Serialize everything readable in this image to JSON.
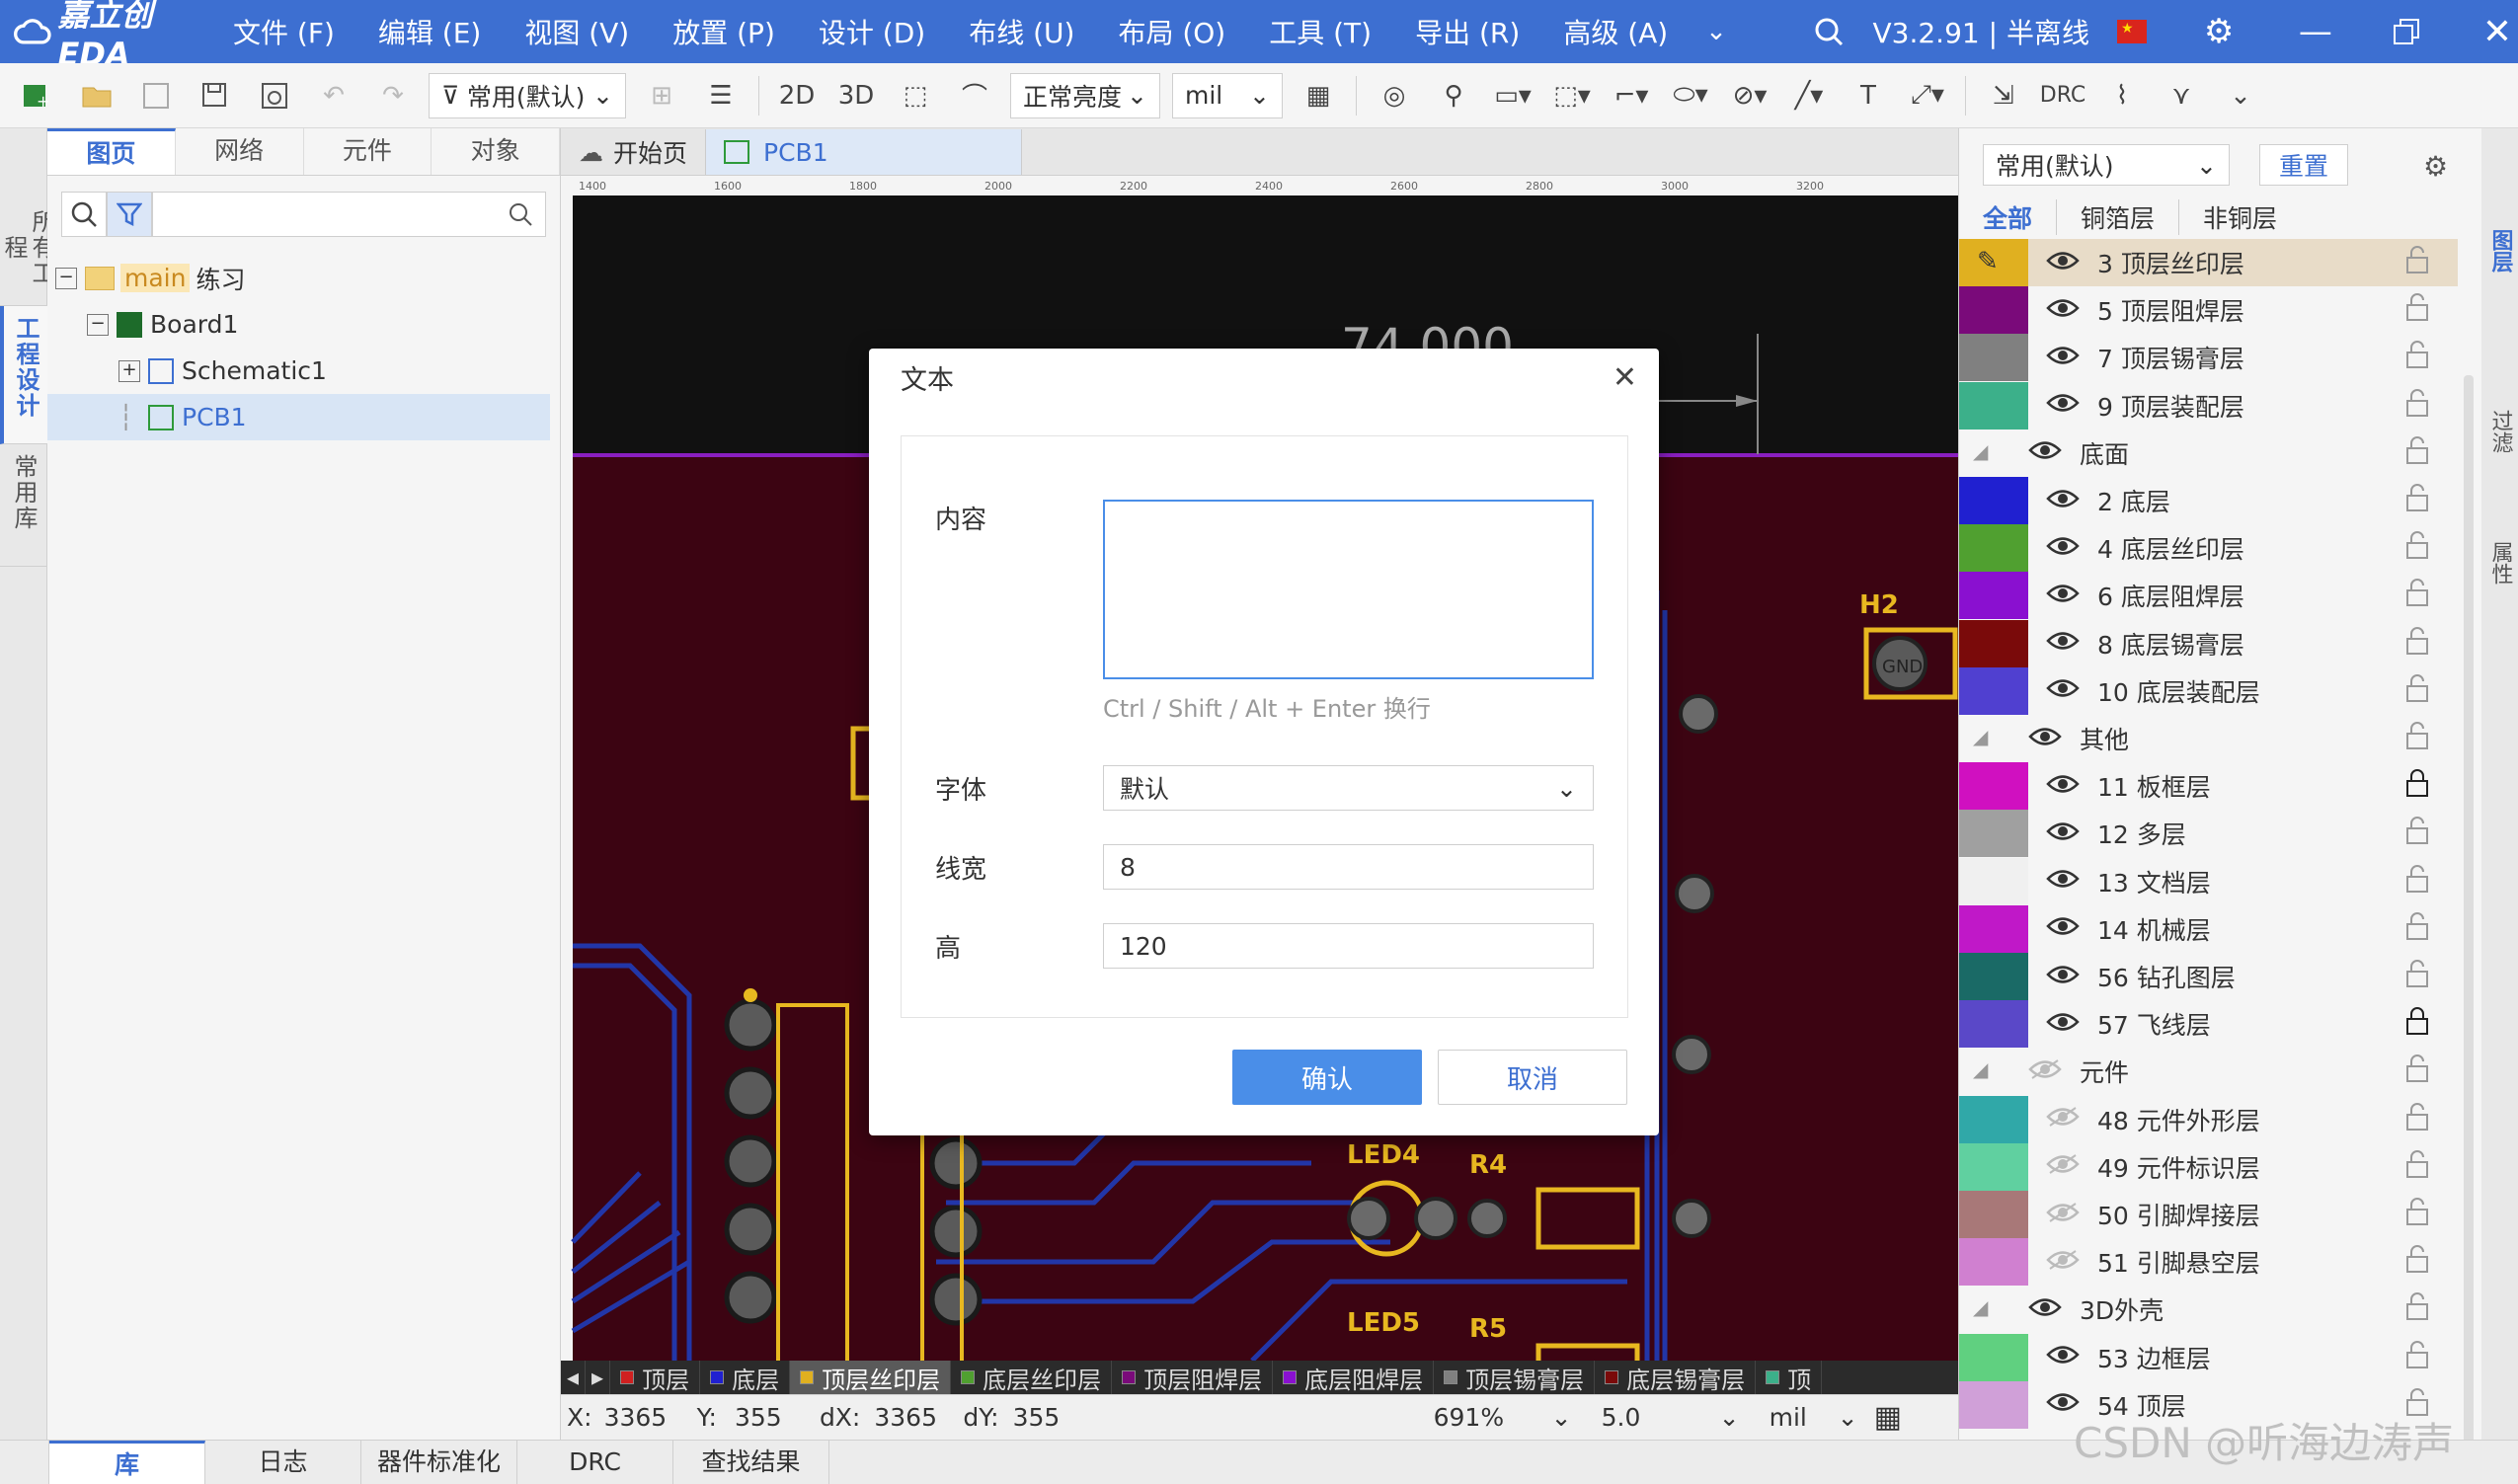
{
  "app": {
    "logo_text": "嘉立创EDA",
    "version_label": "V3.2.91 | 半离线",
    "menus": [
      "文件 (F)",
      "编辑 (E)",
      "视图 (V)",
      "放置 (P)",
      "设计 (D)",
      "布线 (U)",
      "布局 (O)",
      "工具 (T)",
      "导出 (R)",
      "高级 (A)"
    ],
    "accent": "#3d6fd1"
  },
  "toolbar": {
    "filter_value": "常用(默认)",
    "view_2d": "2D",
    "view_3d": "3D",
    "brightness_value": "正常亮度",
    "unit_value": "mil",
    "drc_label": "DRC"
  },
  "left_vertical_tabs": [
    "所有工程",
    "工程设计",
    "常用库"
  ],
  "left_panel": {
    "tabs": [
      "图页",
      "网络",
      "元件",
      "对象"
    ],
    "search_placeholder": "",
    "tree": {
      "project_badge": "main",
      "project_name": "练习",
      "board": "Board1",
      "schematic": "Schematic1",
      "pcb": "PCB1"
    }
  },
  "doc_tabs": [
    "开始页",
    "PCB1"
  ],
  "canvas": {
    "ruler_ticks": [
      "1400",
      "1600",
      "1800",
      "2000",
      "2200",
      "2400",
      "2600",
      "2800",
      "3000",
      "3200"
    ],
    "labels": [
      "H2",
      "LED4",
      "R4",
      "LED5",
      "R5",
      "GND"
    ],
    "dimension_text": "74.000"
  },
  "dialog": {
    "title": "文本",
    "content_label": "内容",
    "content_value": "",
    "content_hint": "Ctrl / Shift / Alt + Enter 换行",
    "font_label": "字体",
    "font_value": "默认",
    "linewidth_label": "线宽",
    "linewidth_value": "8",
    "height_label": "高",
    "height_value": "120",
    "confirm_label": "确认",
    "cancel_label": "取消"
  },
  "right_panel": {
    "preset_value": "常用(默认)",
    "reset_label": "重置",
    "filter_tabs": [
      "全部",
      "铜箔层",
      "非铜层"
    ],
    "layers": [
      {
        "name": "3 顶层丝印层",
        "color": "#e0b020",
        "group": false,
        "active": true,
        "locked": false,
        "visible": true
      },
      {
        "name": "5 顶层阻焊层",
        "color": "#7a0a7a",
        "group": false,
        "locked": false,
        "visible": true
      },
      {
        "name": "7 顶层锡膏层",
        "color": "#808080",
        "group": false,
        "locked": false,
        "visible": true
      },
      {
        "name": "9 顶层装配层",
        "color": "#3cb08a",
        "group": false,
        "locked": false,
        "visible": true
      },
      {
        "name": "底面",
        "color": "",
        "group": true,
        "locked": false,
        "visible": true
      },
      {
        "name": "2 底层",
        "color": "#2020d0",
        "group": false,
        "locked": false,
        "visible": true
      },
      {
        "name": "4 底层丝印层",
        "color": "#50a030",
        "group": false,
        "locked": false,
        "visible": true
      },
      {
        "name": "6 底层阻焊层",
        "color": "#8a10d0",
        "group": false,
        "locked": false,
        "visible": true
      },
      {
        "name": "8 底层锡膏层",
        "color": "#7a0a0a",
        "group": false,
        "locked": false,
        "visible": true
      },
      {
        "name": "10 底层装配层",
        "color": "#5040d0",
        "group": false,
        "locked": false,
        "visible": true
      },
      {
        "name": "其他",
        "color": "",
        "group": true,
        "locked": false,
        "visible": true
      },
      {
        "name": "11 板框层",
        "color": "#d010c0",
        "group": false,
        "locked": true,
        "visible": true
      },
      {
        "name": "12 多层",
        "color": "#a0a0a0",
        "group": false,
        "locked": false,
        "visible": true
      },
      {
        "name": "13 文档层",
        "color": "#f0f0f0",
        "group": false,
        "locked": false,
        "visible": true
      },
      {
        "name": "14 机械层",
        "color": "#c018c8",
        "group": false,
        "locked": false,
        "visible": true
      },
      {
        "name": "56 钻孔图层",
        "color": "#1a6a66",
        "group": false,
        "locked": false,
        "visible": true
      },
      {
        "name": "57 飞线层",
        "color": "#5a48c8",
        "group": false,
        "locked": true,
        "visible": true
      },
      {
        "name": "元件",
        "color": "",
        "group": true,
        "locked": false,
        "visible": false
      },
      {
        "name": "48 元件外形层",
        "color": "#30a8a8",
        "group": false,
        "locked": false,
        "visible": false
      },
      {
        "name": "49 元件标识层",
        "color": "#60d0a0",
        "group": false,
        "locked": false,
        "visible": false
      },
      {
        "name": "50 引脚焊接层",
        "color": "#a87878",
        "group": false,
        "locked": false,
        "visible": false
      },
      {
        "name": "51 引脚悬空层",
        "color": "#d080d0",
        "group": false,
        "locked": false,
        "visible": false
      },
      {
        "name": "3D外壳",
        "color": "",
        "group": true,
        "locked": false,
        "visible": true
      },
      {
        "name": "53 边框层",
        "color": "#60d080",
        "group": false,
        "locked": false,
        "visible": true
      },
      {
        "name": "54 顶层",
        "color": "#d0a0d8",
        "group": false,
        "locked": false,
        "visible": true
      }
    ]
  },
  "right_vertical_tabs": [
    "图层",
    "过滤",
    "属性"
  ],
  "layer_strip": [
    {
      "name": "顶层",
      "color": "#d02020"
    },
    {
      "name": "底层",
      "color": "#2020d0"
    },
    {
      "name": "顶层丝印层",
      "color": "#e0b020",
      "active": true
    },
    {
      "name": "底层丝印层",
      "color": "#50a030"
    },
    {
      "name": "顶层阻焊层",
      "color": "#7a0a7a"
    },
    {
      "name": "底层阻焊层",
      "color": "#8a10d0"
    },
    {
      "name": "顶层锡膏层",
      "color": "#808080"
    },
    {
      "name": "底层锡膏层",
      "color": "#7a0a0a"
    },
    {
      "name": "顶",
      "color": "#3cb08a"
    }
  ],
  "status": {
    "x_label": "X:",
    "x_value": "3365",
    "y_label": "Y:",
    "y_value": "355",
    "dx_label": "dX:",
    "dx_value": "3365",
    "dy_label": "dY:",
    "dy_value": "355",
    "zoom": "691%",
    "grid": "5.0",
    "unit": "mil"
  },
  "bottom_tabs": [
    "库",
    "日志",
    "器件标准化",
    "DRC",
    "查找结果"
  ],
  "watermark": "CSDN @听海边涛声"
}
